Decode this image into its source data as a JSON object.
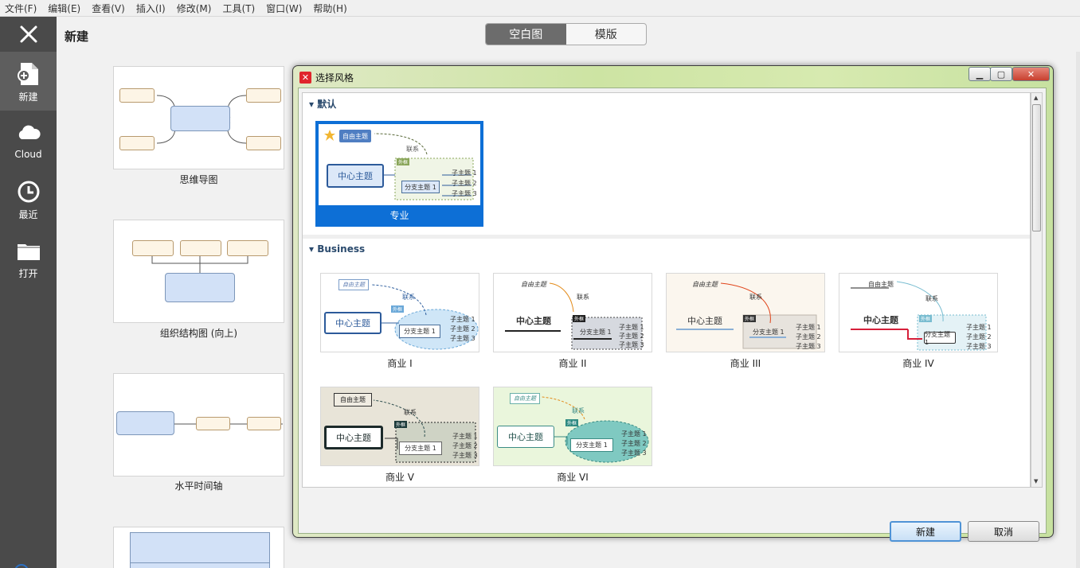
{
  "menu": [
    "文件(F)",
    "编辑(E)",
    "查看(V)",
    "插入(I)",
    "修改(M)",
    "工具(T)",
    "窗口(W)",
    "帮助(H)"
  ],
  "sidebar": {
    "items": [
      {
        "label": "新建",
        "icon": "new-file-icon"
      },
      {
        "label": "Cloud",
        "icon": "cloud-icon"
      },
      {
        "label": "最近",
        "icon": "clock-icon"
      },
      {
        "label": "打开",
        "icon": "folder-icon"
      }
    ]
  },
  "header": {
    "title": "新建",
    "tabs": [
      "空白图",
      "模版"
    ],
    "active_tab": "空白图"
  },
  "templates": [
    {
      "label": "思维导图"
    },
    {
      "label": "组织结构图 (向上)"
    },
    {
      "label": "水平时间轴"
    }
  ],
  "dialog": {
    "title": "选择风格",
    "sections": [
      {
        "title": "默认",
        "styles": [
          {
            "label": "专业"
          }
        ]
      },
      {
        "title": "Business",
        "styles": [
          {
            "label": "商业 I"
          },
          {
            "label": "商业 II"
          },
          {
            "label": "商业 III"
          },
          {
            "label": "商业 IV"
          },
          {
            "label": "商业 V"
          },
          {
            "label": "商业 VI"
          }
        ]
      }
    ],
    "preview_text": {
      "floating": "自由主题",
      "central": "中心主题",
      "branch": "分支主题 1",
      "subs": [
        "子主题 1",
        "子主题 2",
        "子主题 3"
      ],
      "relation": "联系",
      "boundary": "外框"
    },
    "buttons": {
      "ok": "新建",
      "cancel": "取消"
    }
  },
  "colors": {
    "sidebar": "#4a4a4a",
    "selected": "#0d6fd6",
    "dialog_frame": "#cde4a3",
    "accent_red": "#e0252c"
  }
}
